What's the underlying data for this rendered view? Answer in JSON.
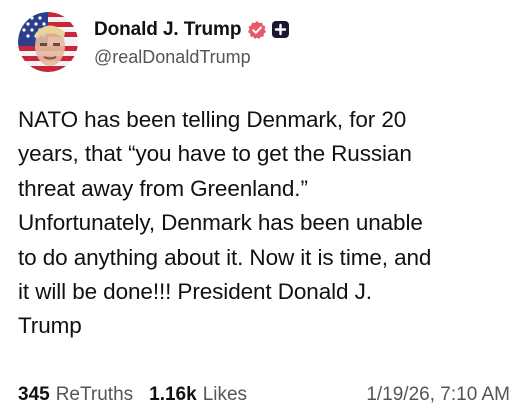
{
  "author": {
    "display_name": "Donald J. Trump",
    "handle": "@realDonaldTrump",
    "verified_icon": "verified-badge-icon",
    "plus_icon": "plus-badge-icon",
    "verified_color": "#e85a6a"
  },
  "post": {
    "text": "NATO has been telling Denmark, for 20\nyears, that “you have to get the Russian\nthreat away from Greenland.”\nUnfortunately, Denmark has been unable\nto do anything about it. Now it is time, and\nit will be done!!! President Donald J.\nTrump"
  },
  "stats": {
    "retruths_count": "345",
    "retruths_label": "ReTruths",
    "likes_count": "1.16k",
    "likes_label": "Likes",
    "timestamp": "1/19/26, 7:10 AM"
  }
}
